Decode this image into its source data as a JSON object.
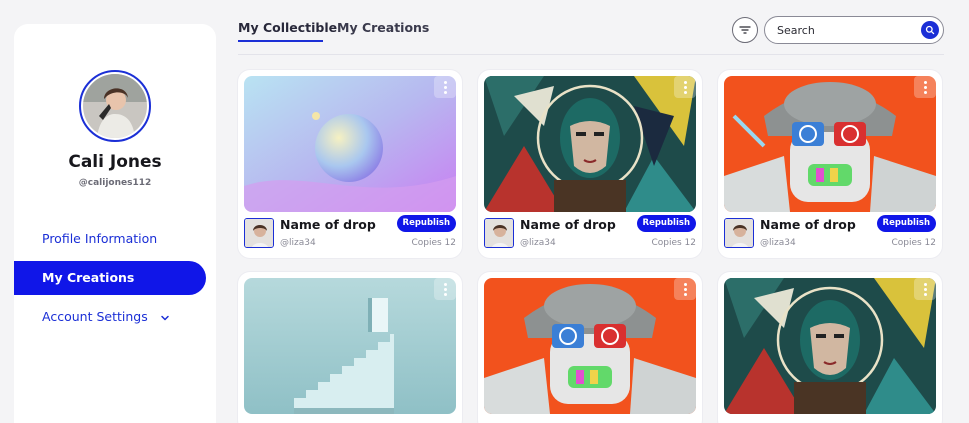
{
  "profile": {
    "name": "Cali Jones",
    "handle": "@calijones112"
  },
  "nav": {
    "profile_info": "Profile Information",
    "my_creations": "My Creations",
    "account_settings": "Account Settings"
  },
  "tabs": {
    "collectible": "My Collectible",
    "creations": "My Creations"
  },
  "search": {
    "placeholder": "Search"
  },
  "cards": [
    {
      "art": "abstract-sphere",
      "name": "Name of drop",
      "creator": "@liza34",
      "action": "Republish",
      "copies": "Copies 12"
    },
    {
      "art": "geometric-portrait",
      "creator": "@liza34",
      "name": "Name of drop",
      "action": "Republish",
      "copies": "Copies 12"
    },
    {
      "art": "robot-3d-glasses",
      "name": "Name of drop",
      "creator": "@liza34",
      "action": "Republish",
      "copies": "Copies 12"
    },
    {
      "art": "floating-stairs"
    },
    {
      "art": "robot-3d-glasses"
    },
    {
      "art": "geometric-portrait"
    }
  ],
  "colors": {
    "accent": "#1016e8",
    "link": "#1b2fd6",
    "background": "#f4f4f6"
  }
}
